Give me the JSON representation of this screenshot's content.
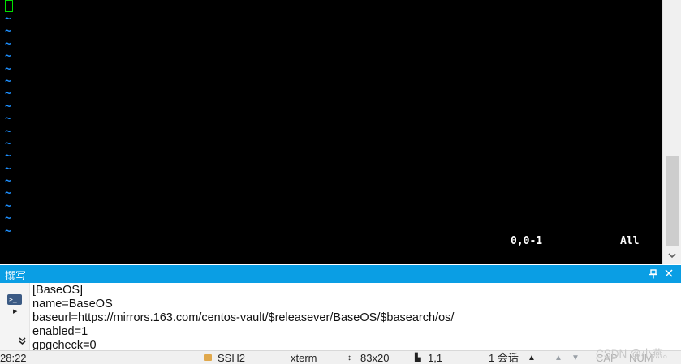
{
  "terminal": {
    "tilde_char": "~",
    "tilde_count": 18,
    "tilde_color": "#1e90ff",
    "cursor_color": "#00e000",
    "ruler_position": "0,0-1",
    "ruler_scroll": "All"
  },
  "compose": {
    "title": "撰写",
    "pin_icon": "pin-icon",
    "close_icon": "close-icon",
    "lines": [
      "[BaseOS]",
      "name=BaseOS",
      "baseurl=https://mirrors.163.com/centos-vault/$releasever/BaseOS/$basearch/os/",
      "enabled=1",
      "gpgcheck=0"
    ],
    "header_color": "#0a9ee4"
  },
  "statusbar": {
    "time": "28:22",
    "protocol": "SSH2",
    "terminal_type": "xterm",
    "size_icon": "↕",
    "size": "83x20",
    "pos_icon": "▙",
    "position": "1,1",
    "sessions": "1 会话",
    "session_menu_icon": "▲",
    "nav_up_icon": "▲",
    "nav_down_icon": "▼",
    "cap": "CAP",
    "num": "NUM"
  },
  "watermark": "CSDN @小燕。"
}
